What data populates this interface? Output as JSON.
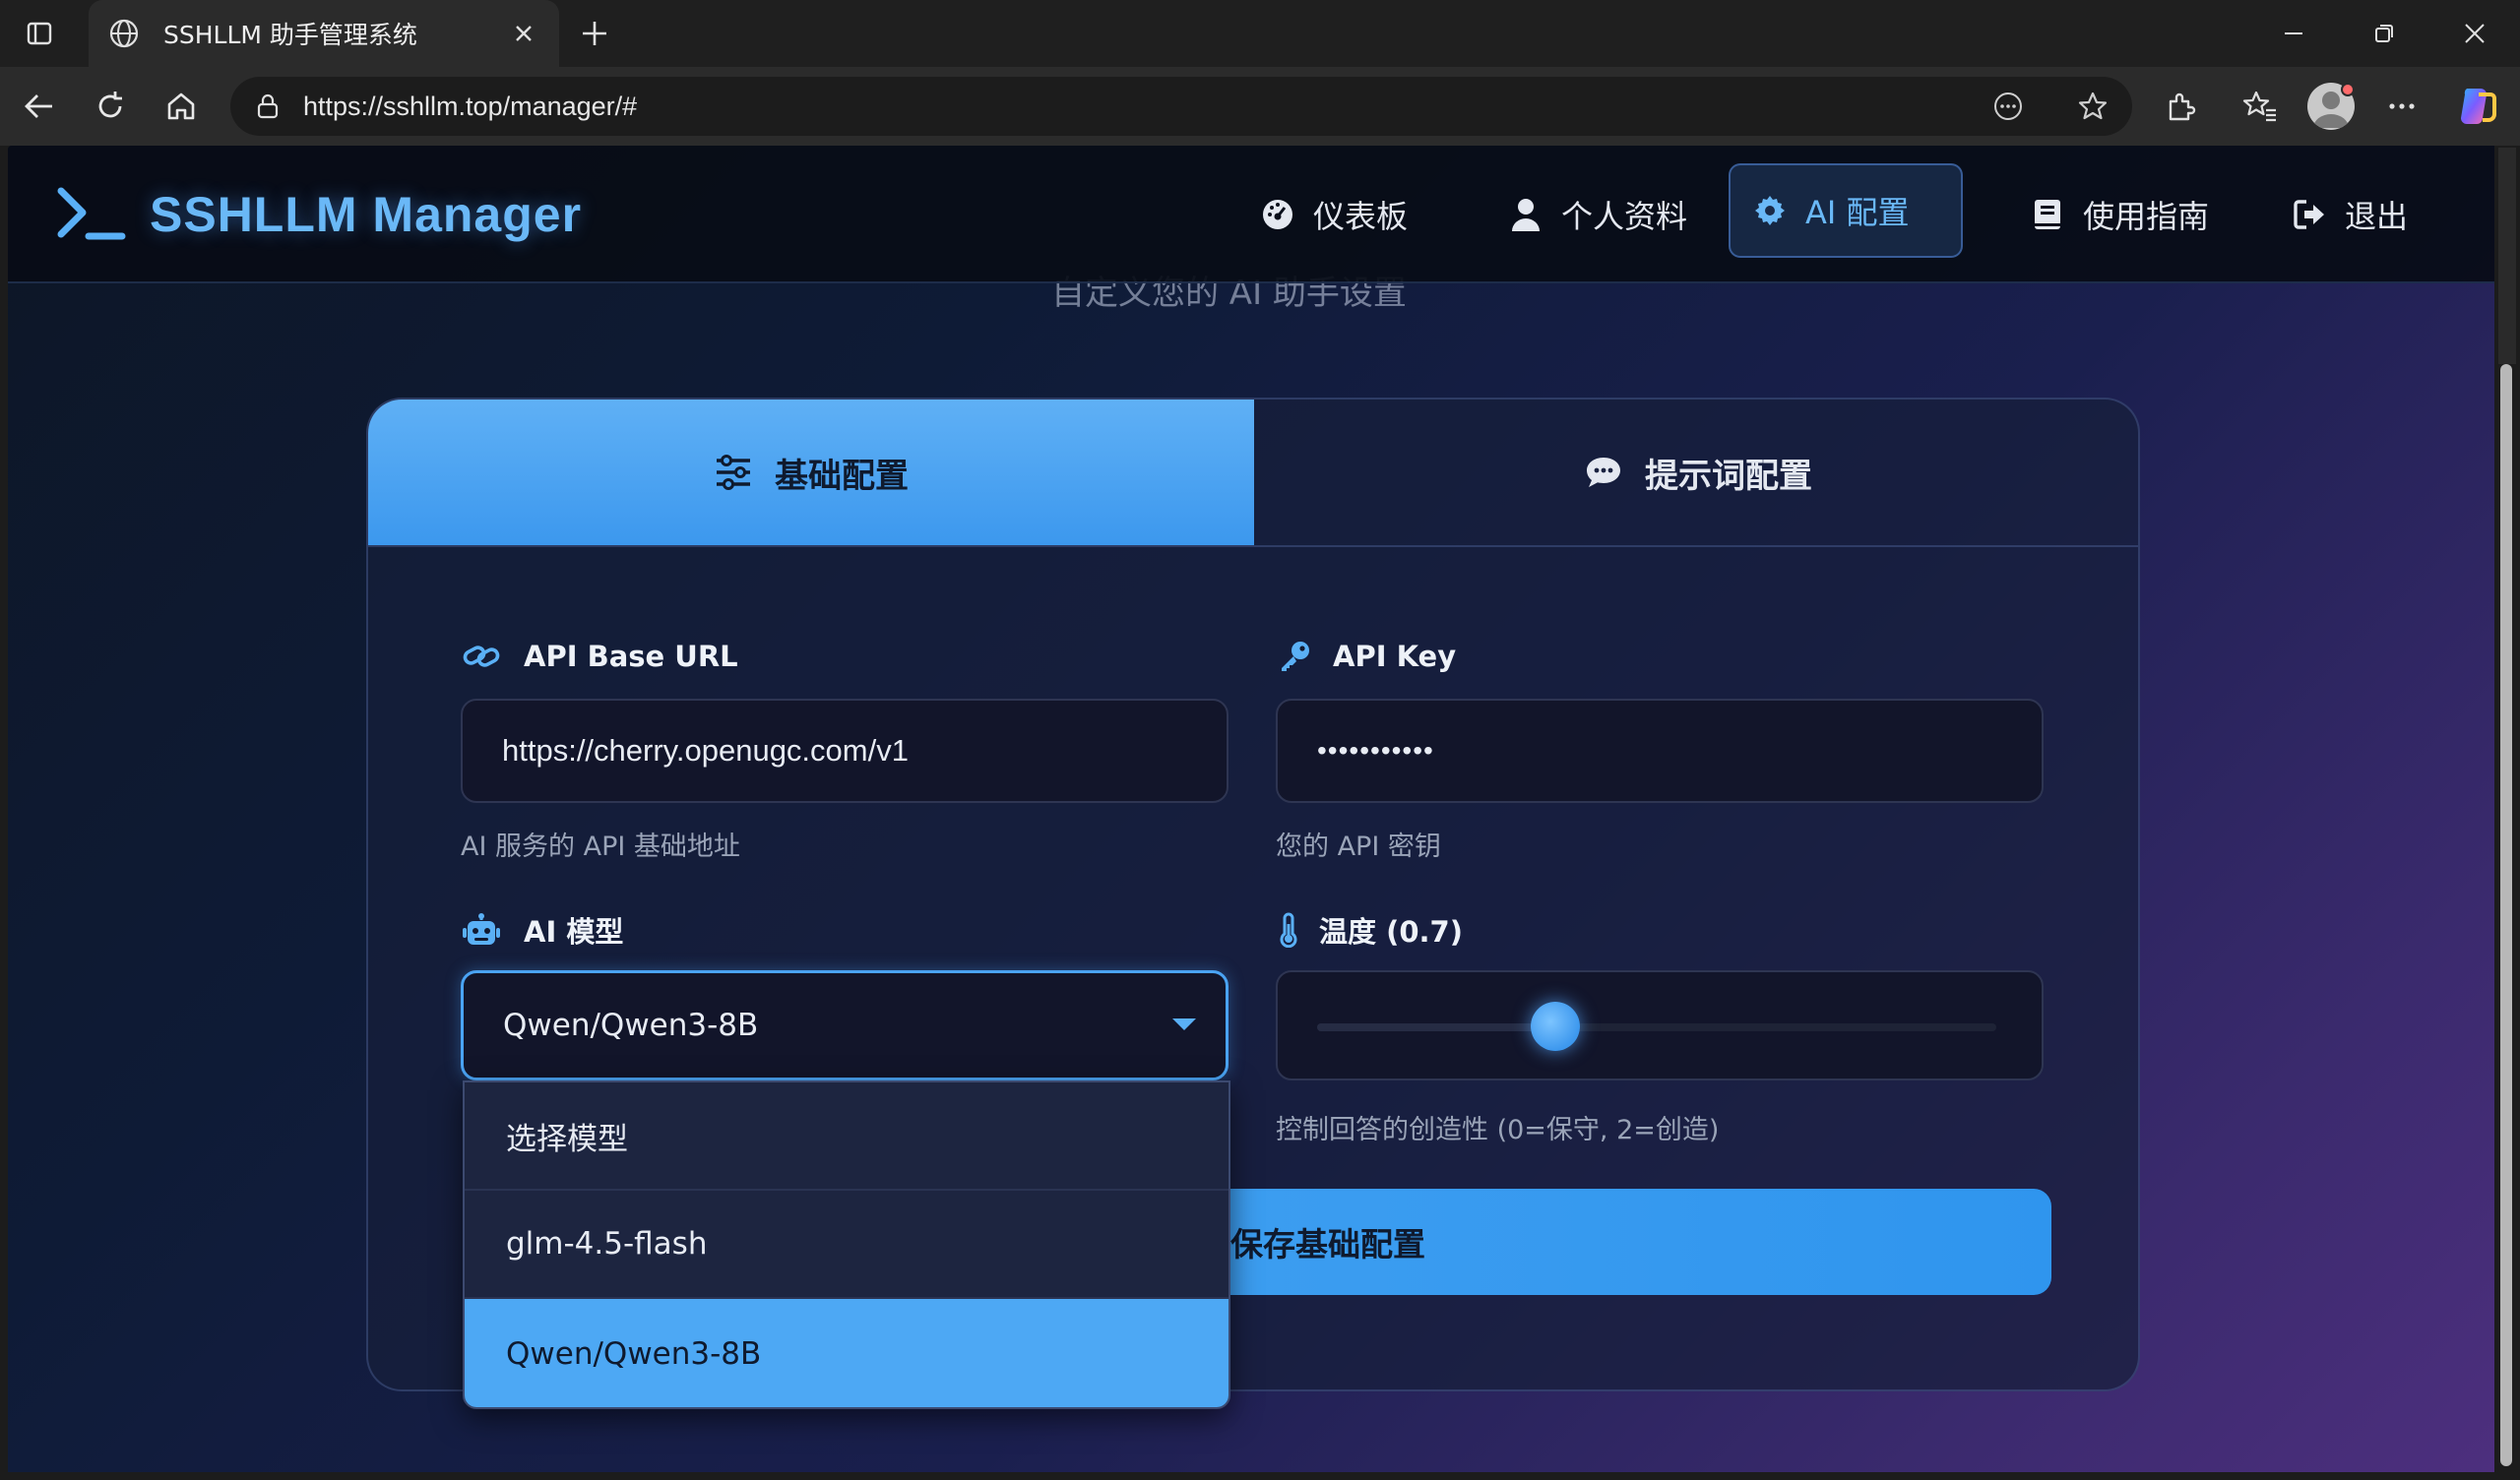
{
  "browser": {
    "tab_title": "SSHLLM 助手管理系统",
    "url": "https://sshllm.top/manager/#"
  },
  "header": {
    "brand": "SSHLLM Manager",
    "nav": [
      {
        "label": "仪表板",
        "icon": "dashboard-icon"
      },
      {
        "label": "个人资料",
        "icon": "user-icon"
      },
      {
        "label": "AI 配置",
        "icon": "gear-icon",
        "active": true
      },
      {
        "label": "使用指南",
        "icon": "book-icon"
      },
      {
        "label": "退出",
        "icon": "logout-icon"
      }
    ]
  },
  "page": {
    "subtitle": "自定义您的 AI 助手设置"
  },
  "tabs": {
    "basic": "基础配置",
    "prompt": "提示词配置"
  },
  "form": {
    "api_base_url": {
      "label": "API Base URL",
      "value": "https://cherry.openugc.com/v1",
      "help": "AI 服务的 API 基础地址"
    },
    "api_key": {
      "label": "API Key",
      "value": "•••••••••••",
      "help": "您的 API 密钥"
    },
    "model": {
      "label": "AI 模型",
      "value": "Qwen/Qwen3-8B",
      "options": [
        "选择模型",
        "glm-4.5-flash",
        "Qwen/Qwen3-8B"
      ],
      "selected_index": 2
    },
    "temperature": {
      "label": "温度 (0.7)",
      "value": 0.7,
      "min": 0,
      "max": 2,
      "help": "控制回答的创造性 (0=保守, 2=创造)"
    },
    "save_label": "保存基础配置"
  },
  "colors": {
    "accent": "#4aa3f3",
    "brand": "#6ab8f7"
  }
}
